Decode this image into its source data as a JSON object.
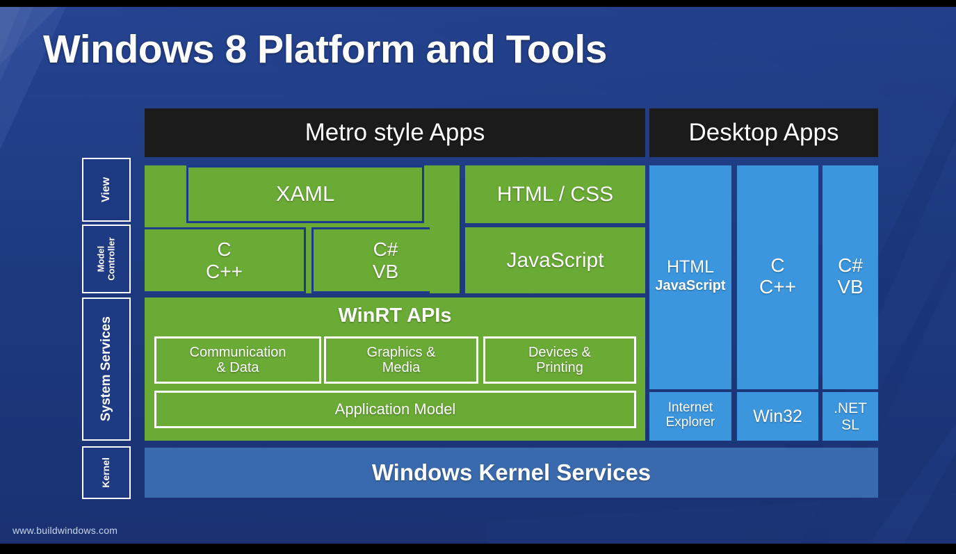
{
  "slide": {
    "title": "Windows 8 Platform and Tools",
    "footer_url": "www.buildwindows.com"
  },
  "colors": {
    "background_blue": "#1e3a80",
    "header_black": "#1b1b1b",
    "metro_green": "#6aab35",
    "desktop_blue": "#3c96de",
    "kernel_blue": "#3a6aae",
    "outline_white": "#ffffff"
  },
  "layers": [
    {
      "id": "view",
      "label": "View"
    },
    {
      "id": "model-controller",
      "label_line1": "Model",
      "label_line2": "Controller"
    },
    {
      "id": "system-services",
      "label": "System Services"
    },
    {
      "id": "kernel",
      "label": "Kernel"
    }
  ],
  "columns": {
    "metro": {
      "header": "Metro style Apps"
    },
    "desktop": {
      "header": "Desktop Apps"
    }
  },
  "metro": {
    "view_row": {
      "xaml": "XAML",
      "html_css": "HTML / CSS"
    },
    "model_controller_row": {
      "c_line1": "C",
      "c_line2": "C++",
      "csharp_line1": "C#",
      "csharp_line2": "VB",
      "javascript": "JavaScript"
    },
    "system_services": {
      "winrt_title": "WinRT APIs",
      "boxes": [
        {
          "line1": "Communication",
          "line2": "& Data"
        },
        {
          "line1": "Graphics &",
          "line2": "Media"
        },
        {
          "line1": "Devices &",
          "line2": "Printing"
        }
      ],
      "application_model": "Application Model"
    }
  },
  "desktop": {
    "columns": [
      {
        "top_line1": "HTML",
        "top_line2": "JavaScript",
        "bottom_line1": "Internet",
        "bottom_line2": "Explorer"
      },
      {
        "top_line1": "C",
        "top_line2": "C++",
        "bottom_line1": "Win32",
        "bottom_line2": ""
      },
      {
        "top_line1": "C#",
        "top_line2": "VB",
        "bottom_line1": ".NET",
        "bottom_line2": "SL"
      }
    ]
  },
  "kernel": {
    "label": "Windows Kernel Services"
  }
}
